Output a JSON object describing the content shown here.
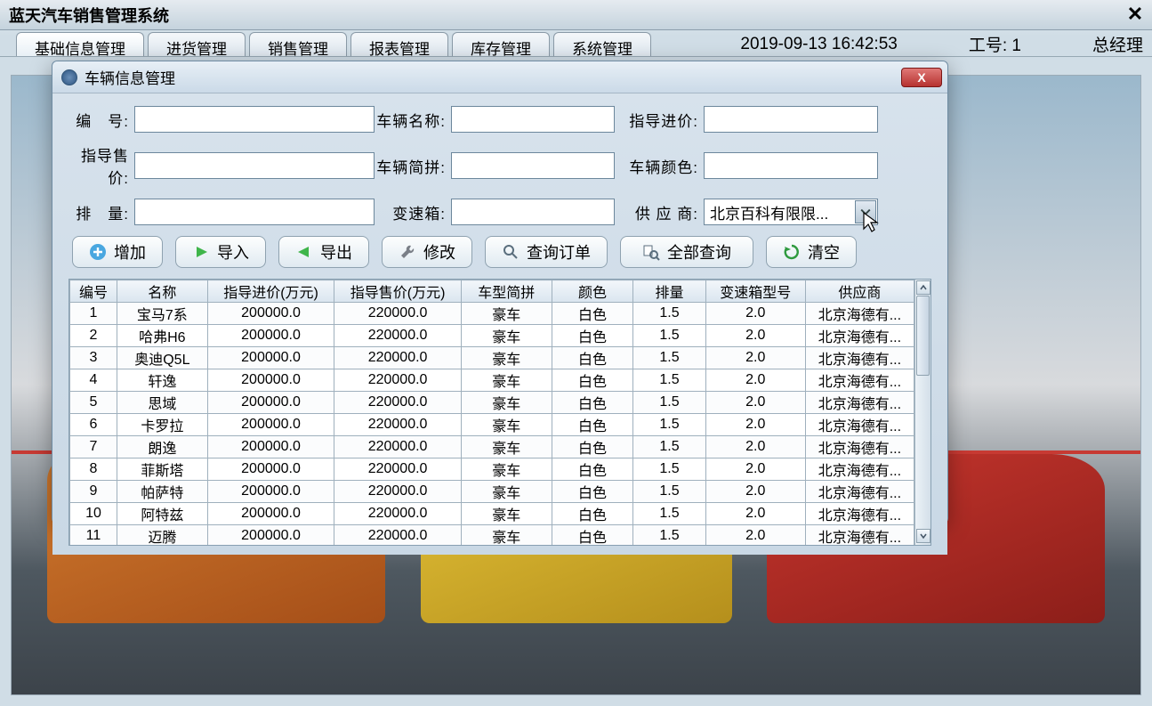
{
  "main": {
    "title": "蓝天汽车销售管理系统",
    "datetime": "2019-09-13 16:42:53",
    "job_no_label": "工号:",
    "job_no_value": "1",
    "role": "总经理"
  },
  "tabs": [
    "基础信息管理",
    "进货管理",
    "销售管理",
    "报表管理",
    "库存管理",
    "系统管理"
  ],
  "dialog": {
    "title": "车辆信息管理",
    "close": "X"
  },
  "form": {
    "f1": {
      "label": "编　号:",
      "value": ""
    },
    "f2": {
      "label": "车辆名称:",
      "value": ""
    },
    "f3": {
      "label": "指导进价:",
      "value": ""
    },
    "f4": {
      "label": "指导售价:",
      "value": ""
    },
    "f5": {
      "label": "车辆简拼:",
      "value": ""
    },
    "f6": {
      "label": "车辆颜色:",
      "value": ""
    },
    "f7": {
      "label": "排　量:",
      "value": ""
    },
    "f8": {
      "label": "变速箱:",
      "value": ""
    },
    "f9": {
      "label": "供 应 商:",
      "value": "北京百科有限限..."
    }
  },
  "buttons": {
    "add": "增加",
    "import": "导入",
    "export": "导出",
    "modify": "修改",
    "query_order": "查询订单",
    "query_all": "全部查询",
    "clear": "清空"
  },
  "table": {
    "headers": [
      "编号",
      "名称",
      "指导进价(万元)",
      "指导售价(万元)",
      "车型简拼",
      "颜色",
      "排量",
      "变速箱型号",
      "供应商"
    ],
    "rows": [
      [
        "1",
        "宝马7系",
        "200000.0",
        "220000.0",
        "豪车",
        "白色",
        "1.5",
        "2.0",
        "北京海德有..."
      ],
      [
        "2",
        "哈弗H6",
        "200000.0",
        "220000.0",
        "豪车",
        "白色",
        "1.5",
        "2.0",
        "北京海德有..."
      ],
      [
        "3",
        "奥迪Q5L",
        "200000.0",
        "220000.0",
        "豪车",
        "白色",
        "1.5",
        "2.0",
        "北京海德有..."
      ],
      [
        "4",
        "轩逸",
        "200000.0",
        "220000.0",
        "豪车",
        "白色",
        "1.5",
        "2.0",
        "北京海德有..."
      ],
      [
        "5",
        "思域",
        "200000.0",
        "220000.0",
        "豪车",
        "白色",
        "1.5",
        "2.0",
        "北京海德有..."
      ],
      [
        "6",
        "卡罗拉",
        "200000.0",
        "220000.0",
        "豪车",
        "白色",
        "1.5",
        "2.0",
        "北京海德有..."
      ],
      [
        "7",
        "朗逸",
        "200000.0",
        "220000.0",
        "豪车",
        "白色",
        "1.5",
        "2.0",
        "北京海德有..."
      ],
      [
        "8",
        "菲斯塔",
        "200000.0",
        "220000.0",
        "豪车",
        "白色",
        "1.5",
        "2.0",
        "北京海德有..."
      ],
      [
        "9",
        "帕萨特",
        "200000.0",
        "220000.0",
        "豪车",
        "白色",
        "1.5",
        "2.0",
        "北京海德有..."
      ],
      [
        "10",
        "阿特兹",
        "200000.0",
        "220000.0",
        "豪车",
        "白色",
        "1.5",
        "2.0",
        "北京海德有..."
      ],
      [
        "11",
        "迈腾",
        "200000.0",
        "220000.0",
        "豪车",
        "白色",
        "1.5",
        "2.0",
        "北京海德有..."
      ]
    ]
  }
}
